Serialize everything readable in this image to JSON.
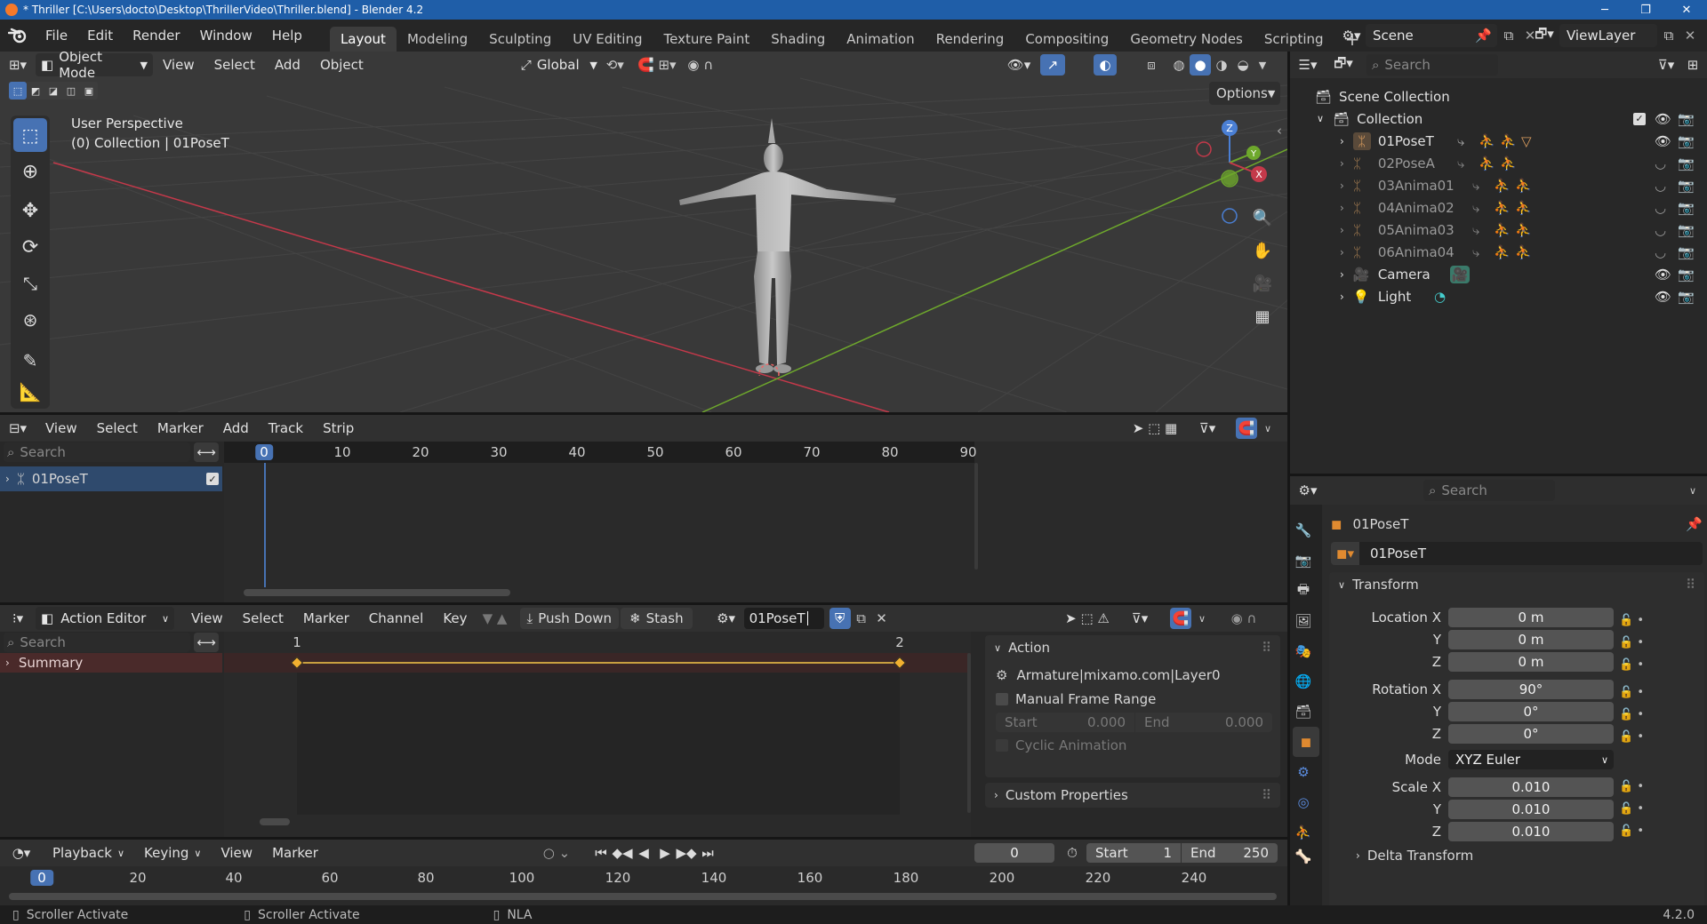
{
  "titlebar": {
    "title": "* Thriller [C:\\Users\\docto\\Desktop\\ThrillerVideo\\Thriller.blend] - Blender 4.2",
    "minimize": "─",
    "maximize": "❐",
    "close": "✕"
  },
  "menu": [
    "File",
    "Edit",
    "Render",
    "Window",
    "Help"
  ],
  "workspaces": [
    "Layout",
    "Modeling",
    "Sculpting",
    "UV Editing",
    "Texture Paint",
    "Shading",
    "Animation",
    "Rendering",
    "Compositing",
    "Geometry Nodes",
    "Scripting"
  ],
  "workspace_add": "+",
  "scene": {
    "name": "Scene",
    "viewlayer": "ViewLayer"
  },
  "viewport": {
    "mode": "Object Mode",
    "menus": [
      "View",
      "Select",
      "Add",
      "Object"
    ],
    "transform_orientation": "Global",
    "options": "Options",
    "overlay_line1": "User Perspective",
    "overlay_line2": "(0) Collection | 01PoseT",
    "gizmo": {
      "z": "Z",
      "y": "Y",
      "x": "X"
    }
  },
  "outliner": {
    "search_placeholder": "Search",
    "scene_collection": "Scene Collection",
    "collection": "Collection",
    "items": [
      {
        "name": "01PoseT",
        "visible": true
      },
      {
        "name": "02PoseA",
        "visible": false
      },
      {
        "name": "03Anima01",
        "visible": false
      },
      {
        "name": "04Anima02",
        "visible": false
      },
      {
        "name": "05Anima03",
        "visible": false
      },
      {
        "name": "06Anima04",
        "visible": false
      },
      {
        "name": "Camera",
        "visible": true
      },
      {
        "name": "Light",
        "visible": true
      }
    ]
  },
  "nla": {
    "menus": [
      "View",
      "Select",
      "Marker",
      "Add",
      "Track",
      "Strip"
    ],
    "search_placeholder": "Search",
    "track": "01PoseT",
    "ticks": [
      "0",
      "10",
      "20",
      "30",
      "40",
      "50",
      "60",
      "70",
      "80",
      "90"
    ],
    "current_frame": "0"
  },
  "action_editor": {
    "mode": "Action Editor",
    "menus": [
      "View",
      "Select",
      "Marker",
      "Channel",
      "Key"
    ],
    "push_down": "Push Down",
    "stash": "Stash",
    "action_name": "01PoseT",
    "search_placeholder": "Search",
    "summary": "Summary",
    "ticks": [
      "1",
      "2"
    ],
    "panel": {
      "action_title": "Action",
      "action_path": "Armature|mixamo.com|Layer0",
      "manual_frame_range": "Manual Frame Range",
      "start_label": "Start",
      "start_value": "0.000",
      "end_label": "End",
      "end_value": "0.000",
      "cyclic": "Cyclic Animation",
      "custom_properties": "Custom Properties"
    }
  },
  "timeline": {
    "menus": [
      "Playback",
      "Keying",
      "View",
      "Marker"
    ],
    "current_frame": "0",
    "start_label": "Start",
    "start_value": "1",
    "end_label": "End",
    "end_value": "250",
    "ticks": [
      "0",
      "20",
      "40",
      "60",
      "80",
      "100",
      "120",
      "140",
      "160",
      "180",
      "200",
      "220",
      "240"
    ]
  },
  "properties": {
    "search_placeholder": "Search",
    "object_name": "01PoseT",
    "datablock_name": "01PoseT",
    "transform_title": "Transform",
    "location_label": "Location X",
    "location": [
      "0 m",
      "0 m",
      "0 m"
    ],
    "rotation_label": "Rotation X",
    "rotation": [
      "90°",
      "0°",
      "0°"
    ],
    "mode_label": "Mode",
    "mode_value": "XYZ Euler",
    "scale_label": "Scale X",
    "scale": [
      "0.010",
      "0.010",
      "0.010"
    ],
    "y_label": "Y",
    "z_label": "Z",
    "delta_transform": "Delta Transform"
  },
  "statusbar": {
    "left": "Scroller Activate",
    "middle": "Scroller Activate",
    "right": "NLA",
    "version": "4.2.0"
  },
  "colors": {
    "accent": "#4772b3",
    "titlebar": "#1f5ea8",
    "keyframe": "#f0b030",
    "x_axis": "#c4394a",
    "y_axis": "#6ea82c"
  }
}
